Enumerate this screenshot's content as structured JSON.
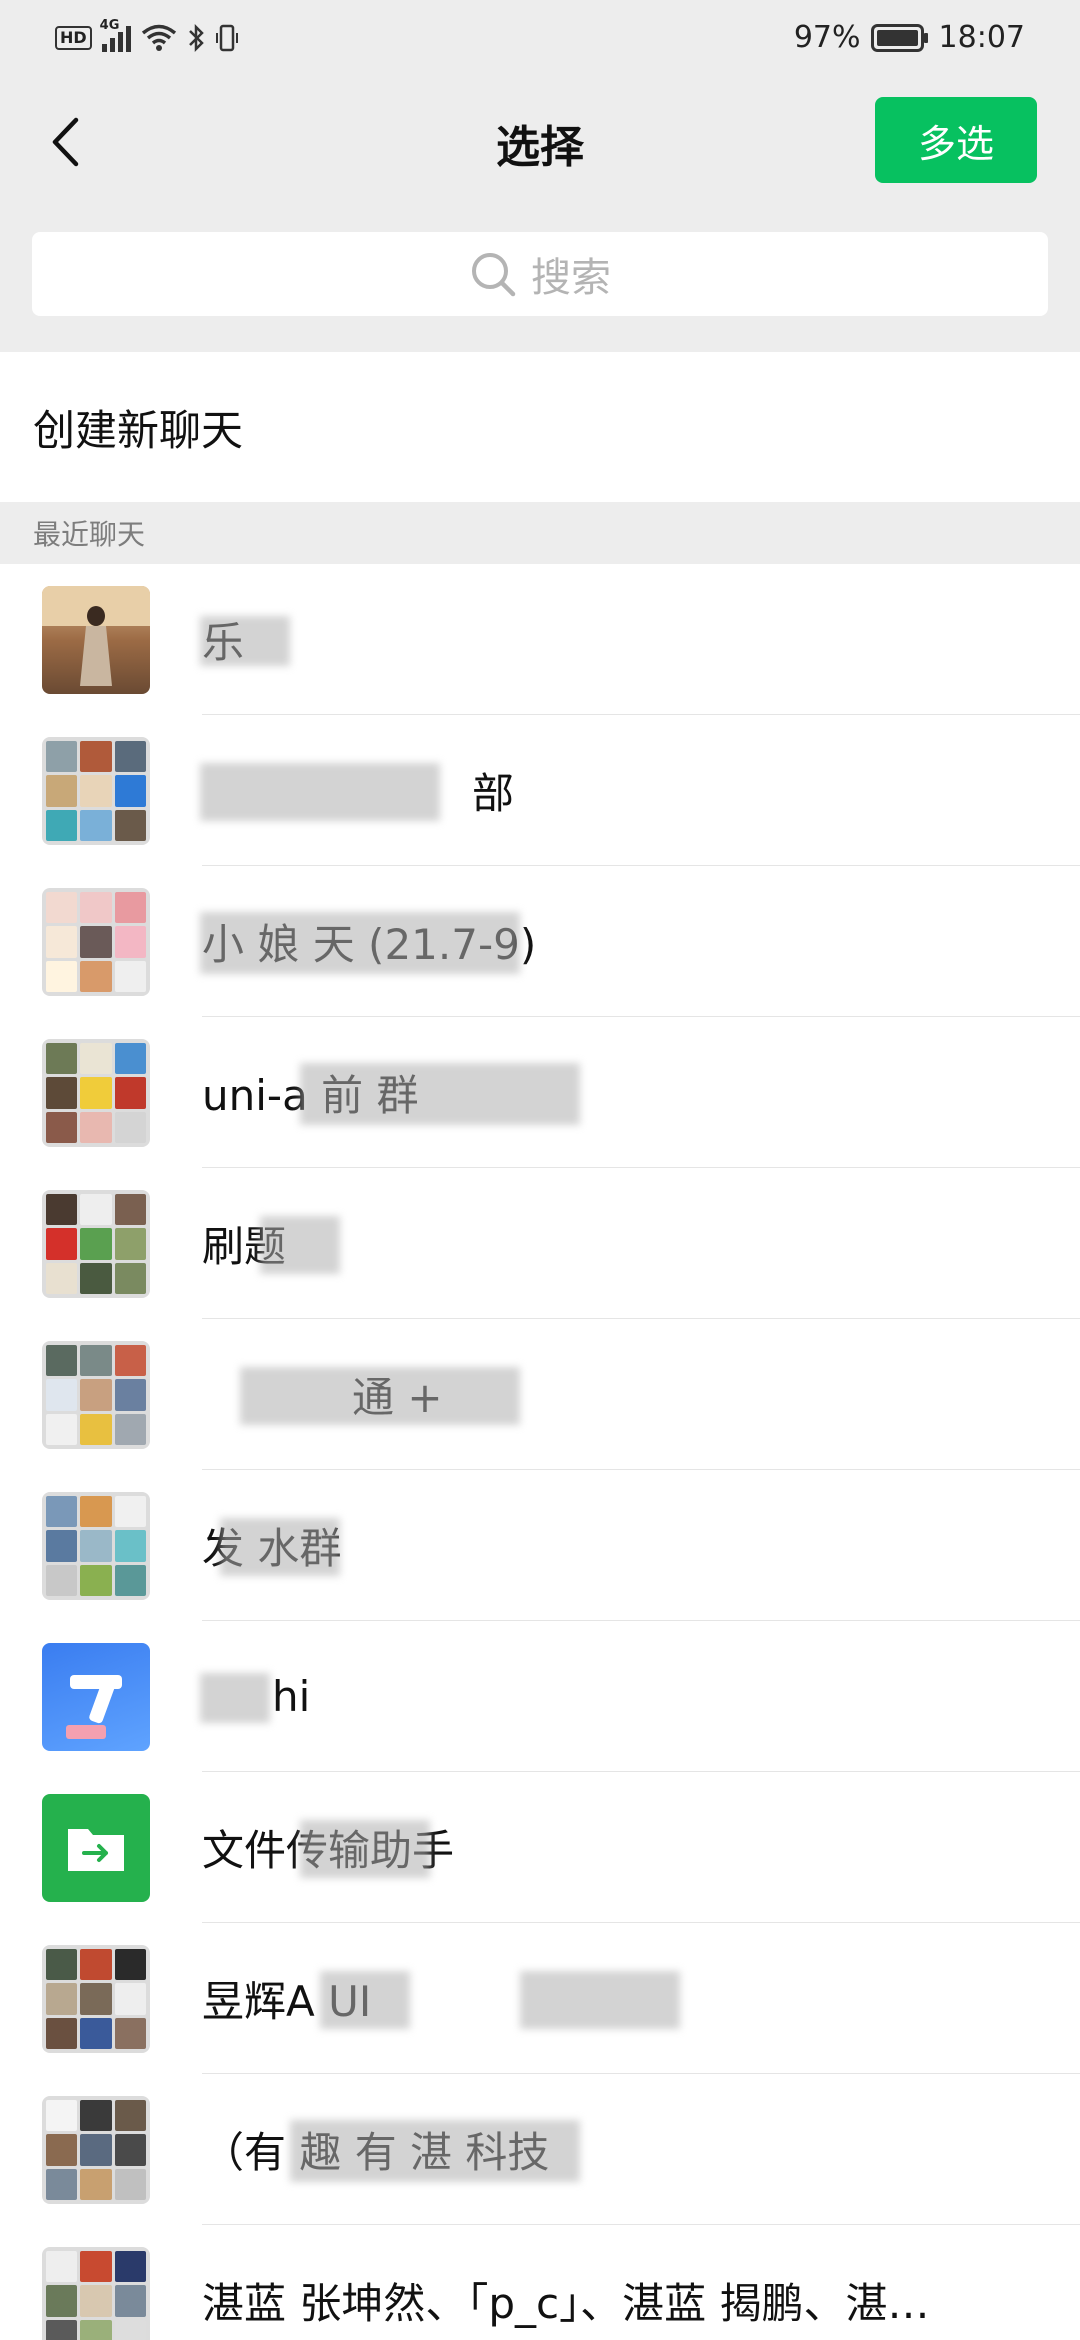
{
  "status_bar": {
    "hd": "HD",
    "network": "4G",
    "battery_pct": "97%",
    "time": "18:07"
  },
  "header": {
    "title": "选择",
    "multi_select_label": "多选"
  },
  "search": {
    "placeholder": "搜索"
  },
  "new_chat_label": "创建新聊天",
  "recent_section_label": "最近聊天",
  "chats": [
    {
      "name": "乐"
    },
    {
      "name": "部"
    },
    {
      "name": "小 娘 天 (21.7-9)"
    },
    {
      "name": "uni-a 前 群"
    },
    {
      "name": "刷题"
    },
    {
      "name": "通 +"
    },
    {
      "name": "发 水群"
    },
    {
      "name": "hi"
    },
    {
      "name": "文件传输助手"
    },
    {
      "name": "昱辉A UI"
    },
    {
      "name": "（有 趣 有 湛 科技"
    },
    {
      "name": "湛蓝 张坤然、「p_c」、湛蓝 揭鹏、湛…"
    }
  ],
  "colors": {
    "accent_green": "#07c160",
    "file_transfer_green": "#25b14d"
  }
}
